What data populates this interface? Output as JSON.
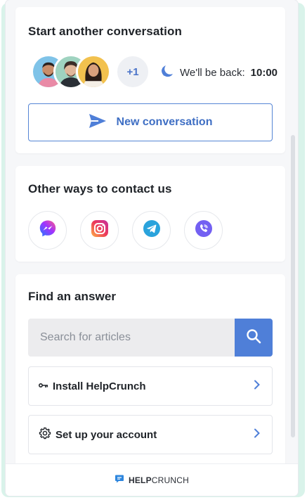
{
  "conversation": {
    "title": "Start another conversation",
    "more_count": "+1",
    "back_prefix": "We'll be back:",
    "back_time": "10:00",
    "new_button_label": "New conversation"
  },
  "contact": {
    "title": "Other ways to contact us",
    "channels": [
      {
        "name": "messenger",
        "icon": "messenger-icon",
        "color": "#8a3ffc"
      },
      {
        "name": "instagram",
        "icon": "instagram-icon",
        "color": "#e4405f"
      },
      {
        "name": "telegram",
        "icon": "telegram-icon",
        "color": "#2aa3dc"
      },
      {
        "name": "viber",
        "icon": "viber-icon",
        "color": "#7360f2"
      }
    ]
  },
  "answers": {
    "title": "Find an answer",
    "search_placeholder": "Search for articles",
    "articles": [
      {
        "label": "Install HelpCrunch",
        "icon": "key-icon"
      },
      {
        "label": "Set up your account",
        "icon": "gear-icon"
      }
    ]
  },
  "footer": {
    "brand_bold": "HELP",
    "brand_rest": "CRUNCH"
  },
  "colors": {
    "accent": "#4f7fd8",
    "backdrop": "#d9f3ea"
  }
}
